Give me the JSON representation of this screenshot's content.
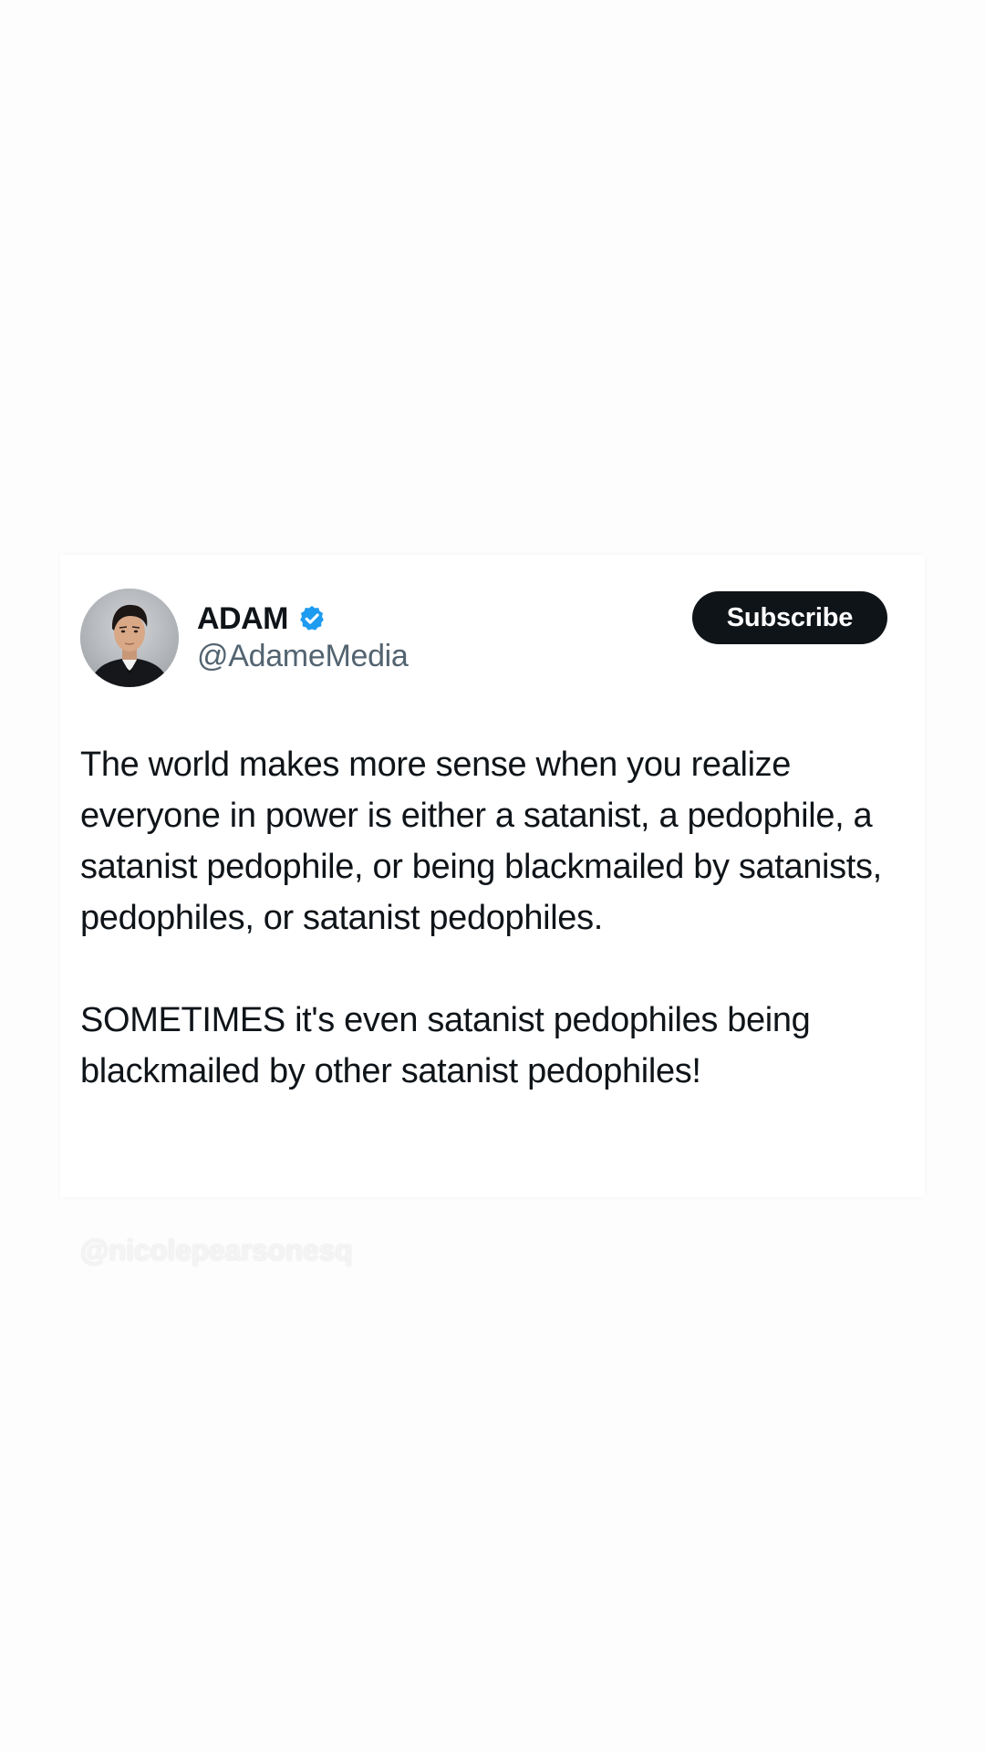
{
  "tweet": {
    "display_name": "ADAM",
    "handle": "@AdameMedia",
    "verified": true,
    "verified_icon": "verified-badge-icon",
    "subscribe_label": "Subscribe",
    "paragraphs": [
      "The world makes more sense when you realize everyone in power is either a satanist, a pedophile, a satanist pedophile, or being blackmailed by satanists, pedophiles, or satanist pedophiles.",
      "SOMETIMES it's even satanist pedophiles being blackmailed by other satanist pedophiles!"
    ]
  },
  "watermark": "@nicolepearsonesq",
  "colors": {
    "background": "#fdfdfd",
    "card": "#ffffff",
    "text": "#0f1419",
    "secondary_text": "#536471",
    "verified_blue": "#1d9bf0",
    "button": "#0f1419"
  }
}
